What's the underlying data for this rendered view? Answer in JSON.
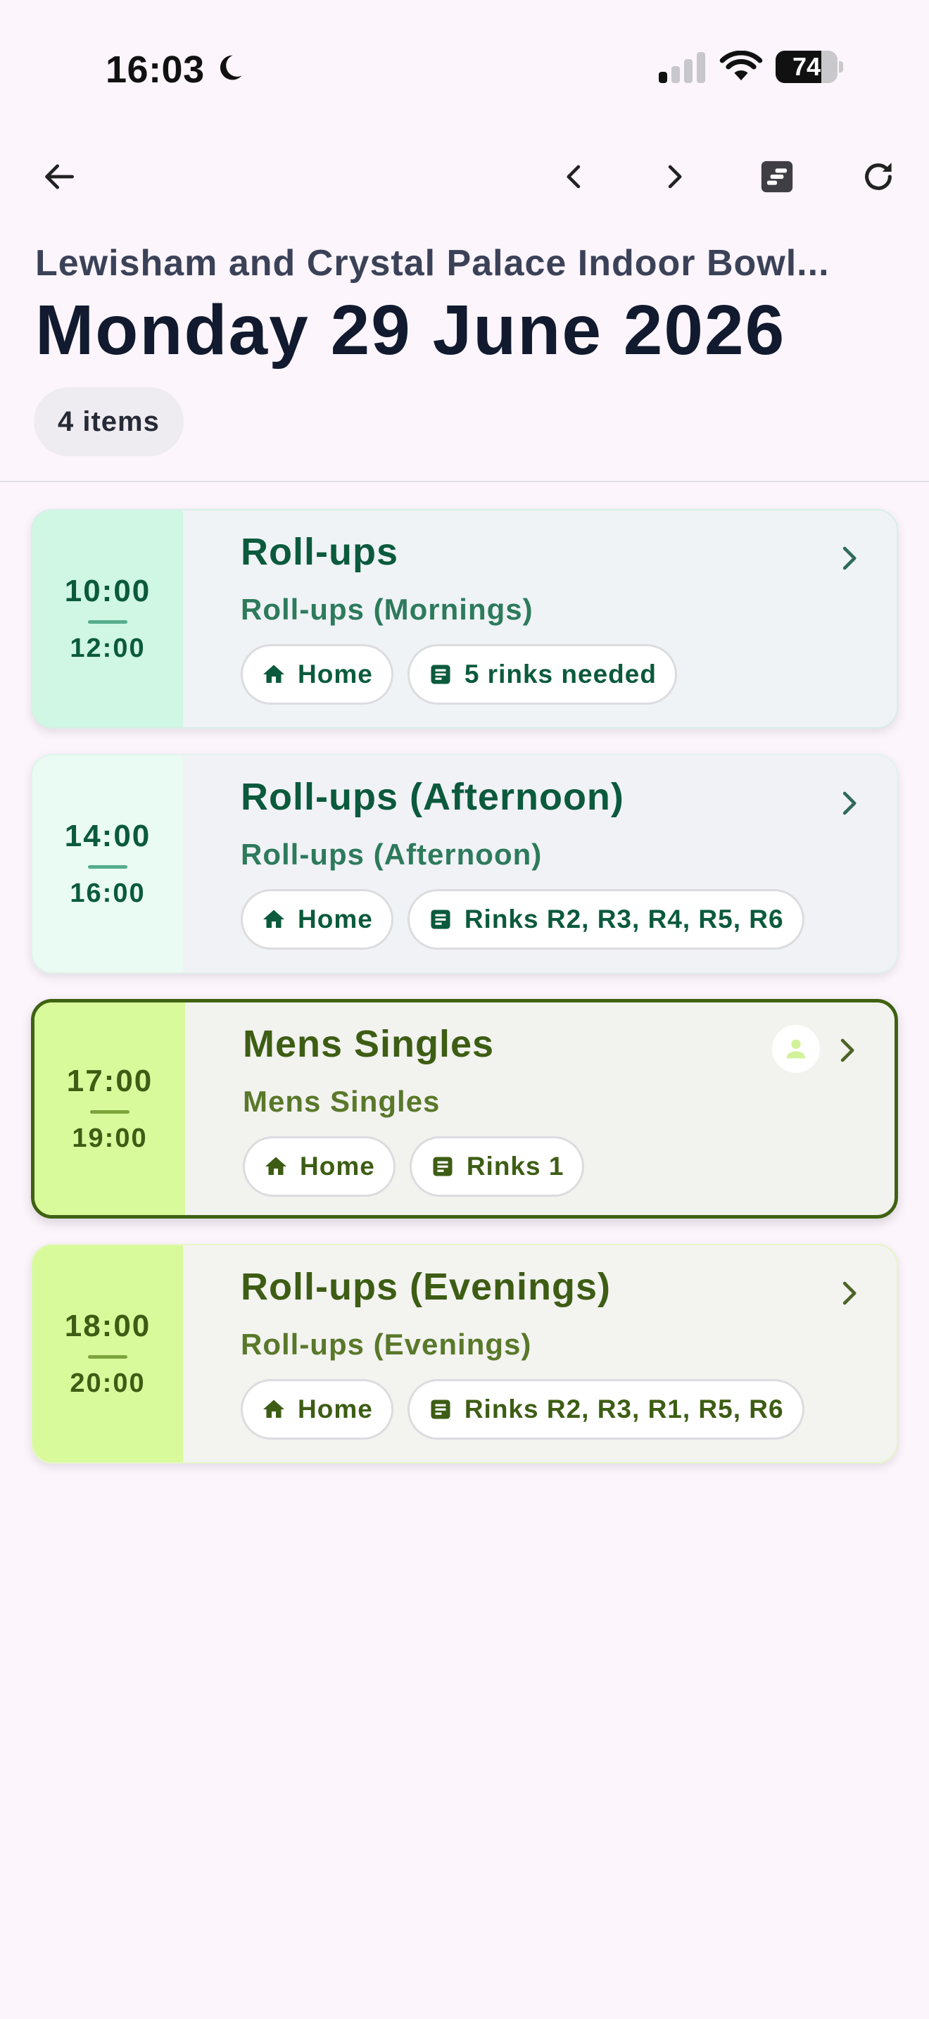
{
  "status_bar": {
    "time": "16:03",
    "battery": "74",
    "battery_level": 0.74,
    "icons": [
      "moon-icon",
      "signal-icon",
      "wifi-icon",
      "battery-icon"
    ]
  },
  "app_bar": {
    "icons": [
      "arrow-back-icon",
      "chevron-left-icon",
      "chevron-right-icon",
      "calendar-icon",
      "refresh-icon"
    ]
  },
  "header": {
    "venue": "Lewisham and Crystal Palace Indoor Bowl...",
    "date": "Monday 29 June 2026",
    "count": "4 items"
  },
  "colors": {
    "background": "#fcf5fc",
    "green_text": "#0b5a3d",
    "olive_text": "#3d5d14",
    "selected_border": "#3f6212"
  },
  "events": [
    {
      "start": "10:00",
      "end": "12:00",
      "title": "Roll-ups",
      "subtitle": "Roll-ups (Mornings)",
      "location": "Home",
      "rinks": "5 rinks needed"
    },
    {
      "start": "14:00",
      "end": "16:00",
      "title": "Roll-ups (Afternoon)",
      "subtitle": "Roll-ups (Afternoon)",
      "location": "Home",
      "rinks": "Rinks R2, R3, R4, R5, R6"
    },
    {
      "start": "17:00",
      "end": "19:00",
      "title": "Mens Singles",
      "subtitle": "Mens Singles",
      "location": "Home",
      "rinks": "Rinks 1",
      "selected": true
    },
    {
      "start": "18:00",
      "end": "20:00",
      "title": "Roll-ups (Evenings)",
      "subtitle": "Roll-ups (Evenings)",
      "location": "Home",
      "rinks": "Rinks R2, R3, R1, R5, R6"
    }
  ]
}
